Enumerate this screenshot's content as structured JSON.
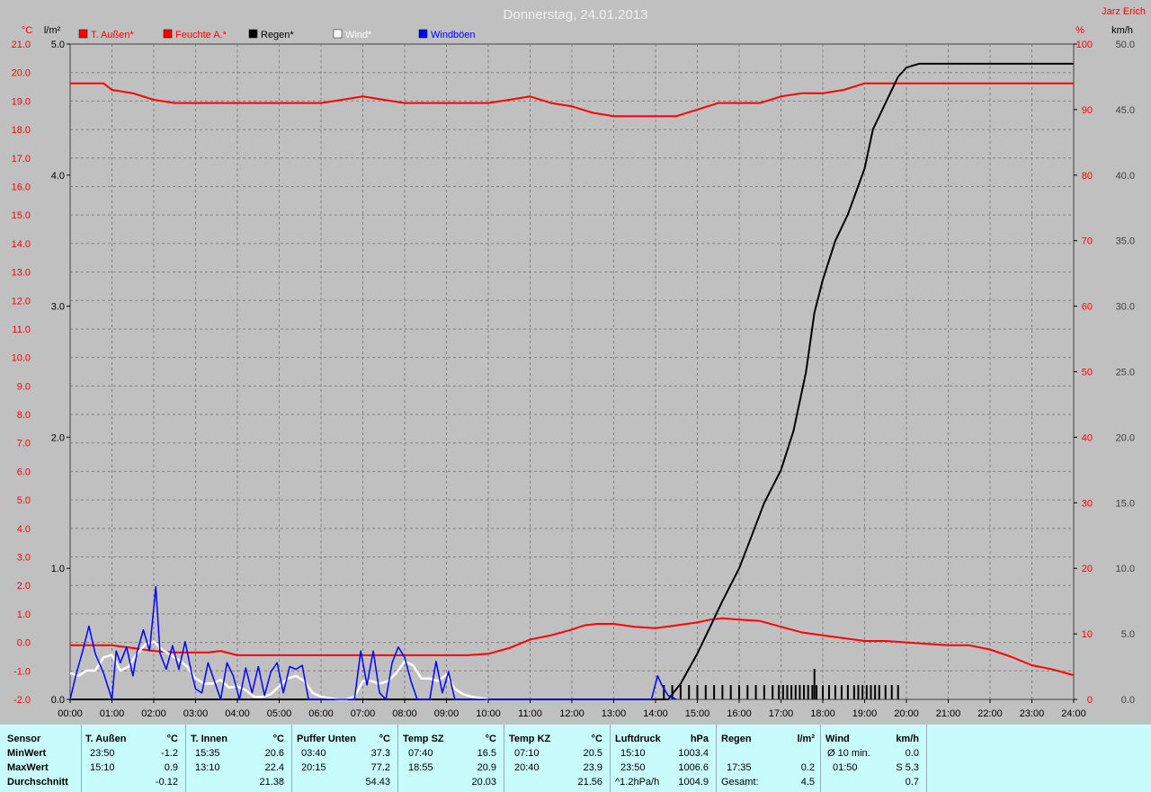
{
  "header": {
    "title": "Donnerstag, 24.01.2013",
    "author": "Jarz Erich"
  },
  "colors": {
    "background": "#c0c0c0",
    "temperature": "#ff0000",
    "humidity": "#ff0000",
    "rain": "#000000",
    "wind": "#ffffff",
    "gusts": "#0000ff",
    "grid": "#808080",
    "stats_bg": "#c8fcfc"
  },
  "axes": {
    "left_outer_unit": "°C",
    "left_inner_unit": "l/m²",
    "right_inner_unit": "%",
    "right_outer_unit": "km/h",
    "temp_ticks": [
      "-2.0",
      "-1.0",
      "0.0",
      "1.0",
      "2.0",
      "3.0",
      "4.0",
      "5.0",
      "6.0",
      "7.0",
      "8.0",
      "9.0",
      "10.0",
      "11.0",
      "12.0",
      "13.0",
      "14.0",
      "15.0",
      "16.0",
      "17.0",
      "18.0",
      "19.0",
      "20.0",
      "21.0"
    ],
    "rain_ticks": [
      "0.0",
      "1.0",
      "2.0",
      "3.0",
      "4.0",
      "5.0"
    ],
    "hum_ticks": [
      "0",
      "10",
      "20",
      "30",
      "40",
      "50",
      "60",
      "70",
      "80",
      "90",
      "100"
    ],
    "wind_ticks": [
      "0.0",
      "5.0",
      "10.0",
      "15.0",
      "20.0",
      "25.0",
      "30.0",
      "35.0",
      "40.0",
      "45.0",
      "50.0"
    ],
    "time_ticks": [
      "00:00",
      "01:00",
      "02:00",
      "03:00",
      "04:00",
      "05:00",
      "06:00",
      "07:00",
      "08:00",
      "09:00",
      "10:00",
      "11:00",
      "12:00",
      "13:00",
      "14:00",
      "15:00",
      "16:00",
      "17:00",
      "18:00",
      "19:00",
      "20:00",
      "21:00",
      "22:00",
      "23:00",
      "24:00"
    ]
  },
  "chart_data": {
    "type": "line",
    "title": "Donnerstag, 24.01.2013",
    "x_unit": "hours",
    "xlim": [
      0,
      24
    ],
    "temp_ylim": [
      -2,
      21
    ],
    "rain_ylim": [
      0,
      5
    ],
    "hum_ylim": [
      0,
      100
    ],
    "wind_ylim": [
      0,
      50
    ],
    "grid": true,
    "legend": "top-left",
    "series": [
      {
        "name": "T. Außen*",
        "axis": "temp",
        "color": "#ff0000",
        "x": [
          0,
          0.5,
          1,
          1.5,
          2,
          2.5,
          3,
          3.3,
          3.6,
          4,
          4.5,
          5,
          5.5,
          6,
          6.5,
          7,
          7.5,
          8,
          8.5,
          9,
          9.5,
          10,
          10.5,
          11,
          11.5,
          12,
          12.3,
          12.6,
          13,
          13.5,
          14,
          14.5,
          15,
          15.3,
          15.6,
          16,
          16.5,
          17,
          17.5,
          18,
          18.5,
          19,
          19.5,
          20,
          20.5,
          21,
          21.5,
          22,
          22.5,
          23,
          23.5,
          24
        ],
        "y": [
          -0.1,
          -0.1,
          -0.1,
          -0.2,
          -0.3,
          -0.35,
          -0.35,
          -0.35,
          -0.3,
          -0.45,
          -0.45,
          -0.45,
          -0.45,
          -0.45,
          -0.45,
          -0.45,
          -0.45,
          -0.45,
          -0.45,
          -0.45,
          -0.45,
          -0.4,
          -0.2,
          0.1,
          0.25,
          0.45,
          0.6,
          0.65,
          0.65,
          0.55,
          0.5,
          0.6,
          0.7,
          0.8,
          0.85,
          0.8,
          0.75,
          0.55,
          0.35,
          0.25,
          0.15,
          0.05,
          0.05,
          0,
          -0.05,
          -0.1,
          -0.1,
          -0.25,
          -0.5,
          -0.8,
          -0.95,
          -1.15
        ]
      },
      {
        "name": "Feuchte A.*",
        "axis": "hum",
        "color": "#ff0000",
        "x": [
          0,
          0.5,
          0.8,
          1,
          1.5,
          2,
          2.5,
          3,
          4,
          5,
          6,
          6.5,
          7,
          7.5,
          8,
          8.5,
          9,
          10,
          10.5,
          11,
          11.5,
          12,
          12.5,
          13,
          14,
          14.5,
          15,
          15.5,
          16,
          16.5,
          17,
          17.5,
          18,
          18.5,
          19,
          19.5,
          20,
          21,
          22,
          23,
          24
        ],
        "y": [
          94,
          94,
          94,
          93,
          92.5,
          91.5,
          91,
          91,
          91,
          91,
          91,
          91.5,
          92,
          91.5,
          91,
          91,
          91,
          91,
          91.5,
          92,
          91,
          90.5,
          89.5,
          89,
          89,
          89,
          90,
          91,
          91,
          91,
          92,
          92.5,
          92.5,
          93,
          94,
          94,
          94,
          94,
          94,
          94,
          94
        ]
      },
      {
        "name": "Regen*",
        "axis": "rain",
        "color": "#000000",
        "x": [
          0,
          14,
          14.3,
          14.6,
          15,
          15.3,
          15.6,
          16,
          16.3,
          16.6,
          17,
          17.3,
          17.6,
          17.8,
          18,
          18.3,
          18.6,
          19,
          19.2,
          19.5,
          19.8,
          20,
          20.3,
          20.6,
          21,
          22,
          23,
          24
        ],
        "y": [
          0,
          0,
          0,
          0.12,
          0.35,
          0.55,
          0.75,
          1.0,
          1.25,
          1.5,
          1.75,
          2.05,
          2.5,
          2.95,
          3.2,
          3.5,
          3.7,
          4.05,
          4.35,
          4.55,
          4.75,
          4.82,
          4.85,
          4.85,
          4.85,
          4.85,
          4.85,
          4.85
        ]
      },
      {
        "name": "Wind*",
        "axis": "wind",
        "color": "#ffffff",
        "x": [
          0,
          0.2,
          0.4,
          0.6,
          0.8,
          1,
          1.2,
          1.4,
          1.6,
          1.8,
          2,
          2.2,
          2.4,
          2.6,
          2.8,
          3,
          3.2,
          3.4,
          3.6,
          3.8,
          4,
          4.2,
          4.4,
          4.6,
          4.8,
          5,
          5.2,
          5.4,
          5.6,
          5.8,
          6,
          6.2,
          6.4,
          6.6,
          6.8,
          7,
          7.2,
          7.4,
          7.6,
          7.8,
          8,
          8.2,
          8.4,
          8.6,
          8.8,
          9,
          9.2,
          9.4,
          9.6,
          9.8,
          10
        ],
        "y": [
          2,
          1.8,
          2.2,
          2.2,
          3.2,
          3.4,
          2.2,
          2.5,
          3.5,
          4.2,
          4.4,
          3.8,
          3.4,
          3,
          2.5,
          1.6,
          1.2,
          1.2,
          1.5,
          0.9,
          1,
          0.7,
          0.2,
          0.2,
          0.4,
          1,
          1.6,
          1.8,
          1.4,
          0.5,
          0.2,
          0.1,
          0,
          0,
          0.2,
          1.4,
          1.4,
          1.2,
          1.4,
          2,
          2.9,
          2.6,
          1.6,
          1.6,
          1.4,
          1.9,
          0.8,
          0.4,
          0.2,
          0.1,
          0
        ]
      },
      {
        "name": "Windböen",
        "axis": "wind",
        "color": "#0000ff",
        "x": [
          0,
          0.15,
          0.3,
          0.45,
          0.6,
          0.8,
          1,
          1.1,
          1.2,
          1.35,
          1.5,
          1.6,
          1.75,
          1.9,
          2.05,
          2.15,
          2.3,
          2.45,
          2.6,
          2.75,
          2.9,
          3,
          3.15,
          3.3,
          3.45,
          3.6,
          3.75,
          3.9,
          4.05,
          4.2,
          4.35,
          4.5,
          4.65,
          4.8,
          4.95,
          5.1,
          5.25,
          5.4,
          5.55,
          5.7,
          5.85,
          6,
          6.5,
          6.8,
          6.95,
          7.1,
          7.25,
          7.4,
          7.55,
          7.7,
          7.85,
          8,
          8.15,
          8.3,
          8.45,
          8.6,
          8.75,
          8.9,
          9.05,
          9.2,
          9.35,
          9.5,
          10,
          13.5,
          13.9,
          14.05,
          14.15,
          14.3,
          14.5
        ],
        "y": [
          0,
          2,
          3.7,
          5.6,
          3.5,
          2,
          0,
          3.7,
          2.8,
          4.0,
          1.8,
          3.6,
          5.3,
          3.7,
          8.6,
          3.5,
          2.3,
          4.1,
          2.3,
          4.4,
          2.1,
          0.8,
          0.5,
          2.8,
          1.4,
          0,
          2.8,
          1.8,
          0,
          2.4,
          0.5,
          2.5,
          0.3,
          2.1,
          2.8,
          0.5,
          2.5,
          2.3,
          2.6,
          0,
          0,
          0,
          0,
          0,
          3.7,
          1.1,
          3.7,
          0.5,
          0,
          2.8,
          4.0,
          3.2,
          1.4,
          0,
          0,
          0,
          2.9,
          0.5,
          2.1,
          0,
          0,
          0,
          0,
          0,
          0,
          1.8,
          1.1,
          0.3,
          0
        ]
      }
    ],
    "rain_ticks_x": [
      14.2,
      14.4,
      14.6,
      14.8,
      15,
      15.2,
      15.4,
      15.6,
      15.8,
      16,
      16.2,
      16.4,
      16.6,
      16.8,
      16.95,
      17.05,
      17.15,
      17.25,
      17.35,
      17.45,
      17.55,
      17.65,
      17.75,
      17.85,
      18,
      18.15,
      18.3,
      18.45,
      18.6,
      18.75,
      18.85,
      18.95,
      19.05,
      19.15,
      19.25,
      19.35,
      19.5,
      19.65,
      19.8
    ],
    "rain_tick_tall_x": 17.8
  },
  "stats": {
    "row_labels": [
      "Sensor",
      "MinWert",
      "MaxWert",
      "Durchschnitt"
    ],
    "columns": [
      {
        "name": "T. Außen",
        "unit": "°C",
        "min_time": "23:50",
        "min_val": "-1.2",
        "max_time": "15:10",
        "max_val": "0.9",
        "avg_label": "",
        "avg_val": "-0.12"
      },
      {
        "name": "T. Innen",
        "unit": "°C",
        "min_time": "15:35",
        "min_val": "20.6",
        "max_time": "13:10",
        "max_val": "22.4",
        "avg_label": "",
        "avg_val": "21.38"
      },
      {
        "name": "Puffer Unten",
        "unit": "°C",
        "min_time": "03:40",
        "min_val": "37.3",
        "max_time": "20:15",
        "max_val": "77.2",
        "avg_label": "",
        "avg_val": "54.43"
      },
      {
        "name": "Temp SZ",
        "unit": "°C",
        "min_time": "07:40",
        "min_val": "16.5",
        "max_time": "18:55",
        "max_val": "20.9",
        "avg_label": "",
        "avg_val": "20.03"
      },
      {
        "name": "Temp KZ",
        "unit": "°C",
        "min_time": "07:10",
        "min_val": "20.5",
        "max_time": "20:40",
        "max_val": "23.9",
        "avg_label": "",
        "avg_val": "21.56"
      },
      {
        "name": "Luftdruck",
        "unit": "hPa",
        "min_time": "15:10",
        "min_val": "1003.4",
        "max_time": "23:50",
        "max_val": "1006.6",
        "avg_label": "^1.2hPa/h",
        "avg_val": "1004.9"
      },
      {
        "name": "Regen",
        "unit": "l/m²",
        "min_time": "",
        "min_val": "",
        "max_time": "17:35",
        "max_val": "0.2",
        "avg_label": "Gesamt:",
        "avg_val": "4.5"
      },
      {
        "name": "Wind",
        "unit": "km/h",
        "min_time": "Ø 10 min.",
        "min_val": "0.0",
        "max_time": "01:50",
        "max_val": "S 5.3",
        "avg_label": "",
        "avg_val": "0.7"
      }
    ]
  }
}
